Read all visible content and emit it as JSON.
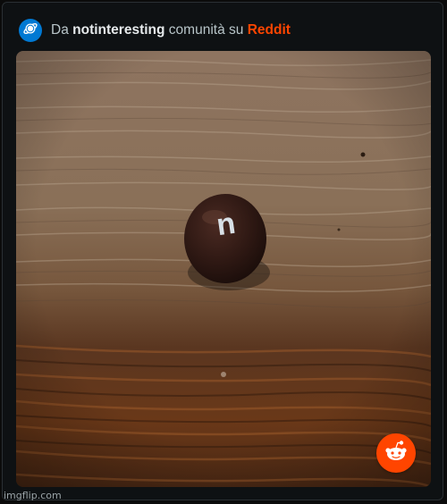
{
  "header": {
    "prefix": "Da",
    "community": "notinteresting",
    "middle": "comunità su",
    "platform": "Reddit",
    "avatar_icon": "planet-icon",
    "platform_color": "#ff4500"
  },
  "post": {
    "image_icon": "candy-photo",
    "candy_letter": "n"
  },
  "badge": {
    "icon": "reddit-snoo-icon",
    "color": "#ff4500"
  },
  "watermark": {
    "text": "imgflip.com"
  }
}
